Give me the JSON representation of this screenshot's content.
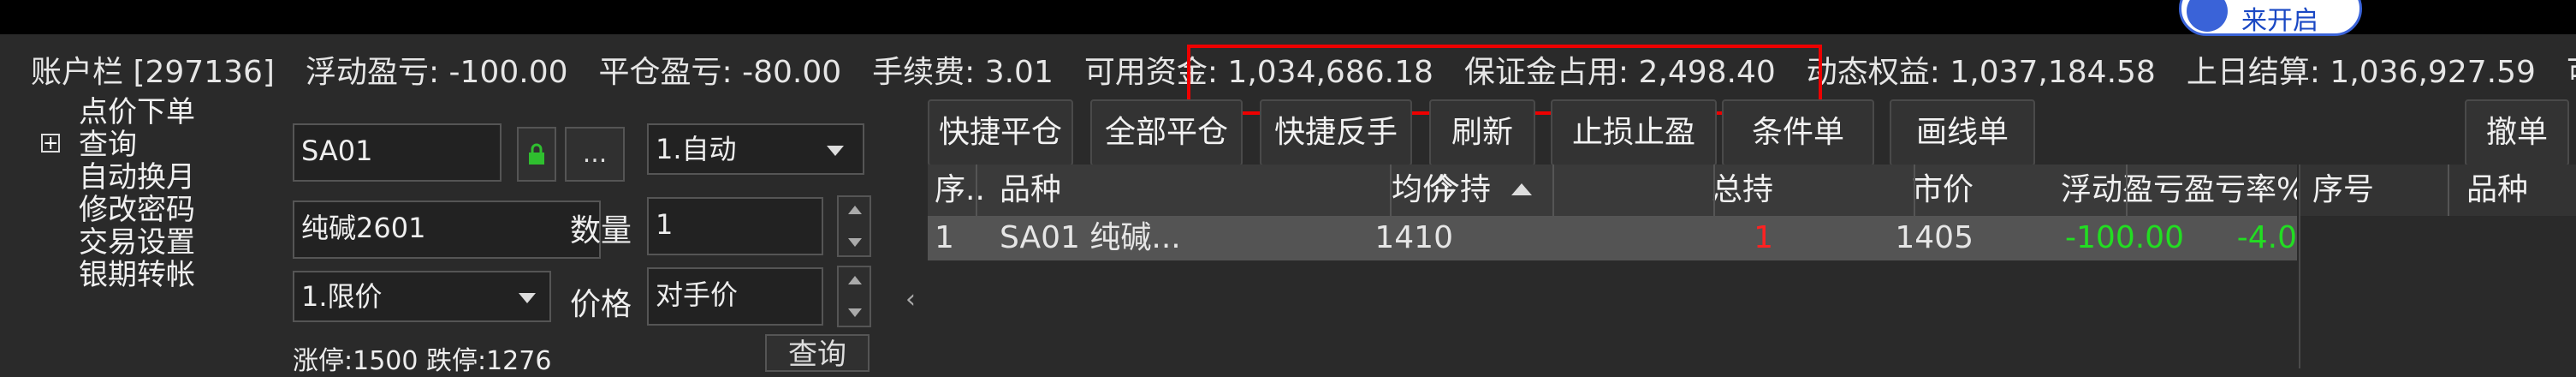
{
  "account_bar": {
    "account": "账户栏 [297136]",
    "floating_pl": "浮动盈亏: -100.00",
    "closed_pl": "平仓盈亏: -80.00",
    "fee": "手续费: 3.01",
    "available": "可用资金: 1,034,686.18",
    "margin": "保证金占用: 2,498.40",
    "equity": "动态权益: 1,037,184.58",
    "prev_settle": "上日结算: 1,036,927.59",
    "cut": "可"
  },
  "top": {
    "button_label": "来开启"
  },
  "menu": {
    "items": [
      "点价下单",
      "查询",
      "自动换月",
      "修改密码",
      "交易设置",
      "银期转帐"
    ]
  },
  "order_form": {
    "contract_code": "SA01",
    "contract_name": "纯碱2601",
    "more_label": "...",
    "mode_value": "1.自动",
    "qty_label": "数量",
    "qty_value": "1",
    "price_type_value": "1.限价",
    "price_label": "价格",
    "price_value": "对手价",
    "limits": "涨停:1500 跌停:1276",
    "query_button": "查询",
    "collapse": "‹"
  },
  "toolbar": {
    "buttons": [
      "快捷平仓",
      "全部平仓",
      "快捷反手",
      "刷新",
      "止损止盈",
      "条件单",
      "画线单"
    ],
    "cancel": "撤单"
  },
  "positions": {
    "headers": [
      "序..",
      "品种",
      "均价",
      "今持",
      "总持",
      "市价",
      "浮动盈亏",
      "盈亏率%"
    ],
    "rows": [
      {
        "seq": "1",
        "symbol": "SA01 纯碱...",
        "avg": "1410",
        "today": "",
        "total": "1",
        "market": "1405",
        "pl": "-100.00",
        "pl_rate": "-4.0"
      }
    ]
  },
  "orders": {
    "headers": [
      "序号",
      "品种"
    ]
  },
  "colors": {
    "loss": "#22dd22",
    "total_red": "#ff2222",
    "highlight_box": "#e00000"
  }
}
